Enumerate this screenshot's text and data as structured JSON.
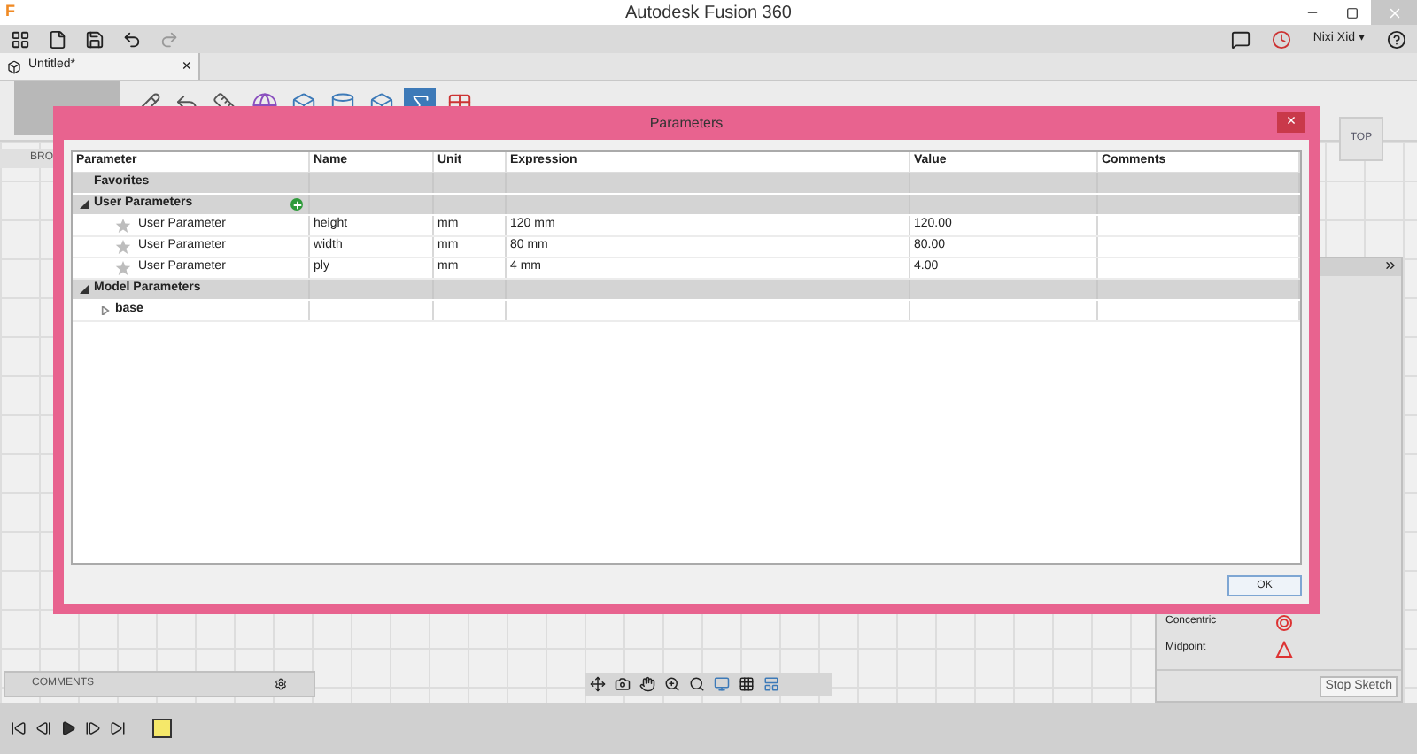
{
  "window": {
    "title": "Autodesk Fusion 360",
    "logo": "F"
  },
  "toolbar": {
    "user": "Nixi Xid ▾"
  },
  "document_tab": {
    "label": "Untitled*",
    "close": "×"
  },
  "browser": {
    "header": "BRO"
  },
  "view_cube": {
    "label": "TOP"
  },
  "dialog": {
    "title": "Parameters",
    "close": "×",
    "columns": [
      "Parameter",
      "Name",
      "Unit",
      "Expression",
      "Value",
      "Comments"
    ],
    "tree": [
      {
        "kind": "group",
        "label": "Favorites"
      },
      {
        "kind": "group",
        "label": "User Parameters",
        "expanded": true,
        "add_button": true,
        "children": [
          {
            "kind": "param",
            "parameter": "User Parameter",
            "name": "height",
            "unit": "mm",
            "expression": "120 mm",
            "value": "120.00"
          },
          {
            "kind": "param",
            "parameter": "User Parameter",
            "name": "width",
            "unit": "mm",
            "expression": "80 mm",
            "value": "80.00"
          },
          {
            "kind": "param",
            "parameter": "User Parameter",
            "name": "ply",
            "unit": "mm",
            "expression": "4 mm",
            "value": "4.00"
          }
        ]
      },
      {
        "kind": "group",
        "label": "Model Parameters",
        "expanded": true,
        "children": [
          {
            "kind": "node",
            "label": "base",
            "expanded": false
          }
        ]
      }
    ],
    "ok_button": "OK"
  },
  "constraints_panel": {
    "items": [
      {
        "kind": "concentric",
        "label": "Concentric"
      },
      {
        "kind": "midpoint",
        "label": "Midpoint"
      }
    ],
    "button": "Stop Sketch"
  },
  "comments_bar": {
    "label": "COMMENTS"
  }
}
